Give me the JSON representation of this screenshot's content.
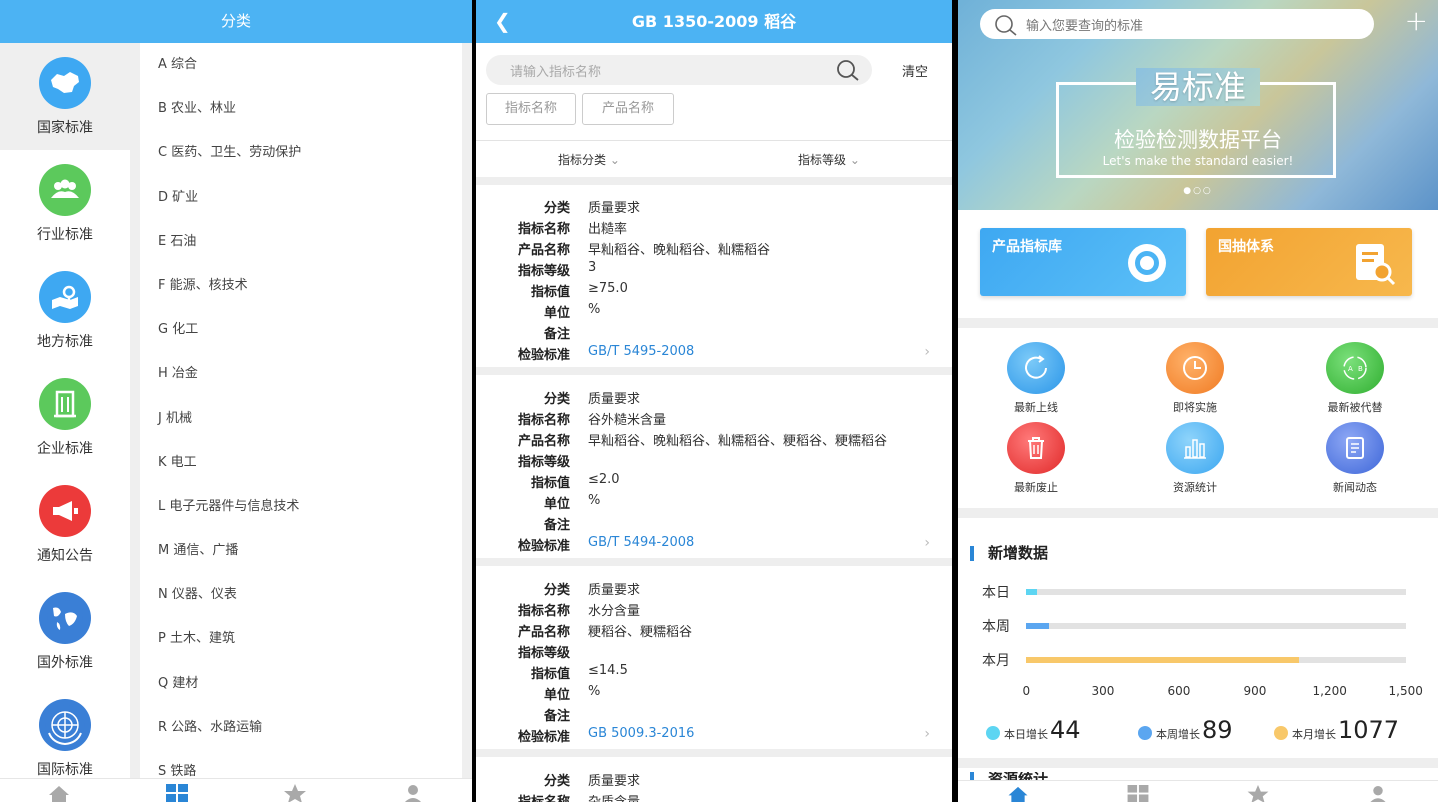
{
  "classify": {
    "header_title": "分类",
    "categories": [
      {
        "label": "国家标准",
        "icon": "china-map-icon",
        "color": "#3ea8f2",
        "active": true
      },
      {
        "label": "行业标准",
        "icon": "people-group-icon",
        "color": "#5cc95c"
      },
      {
        "label": "地方标准",
        "icon": "location-map-icon",
        "color": "#3ea8f2"
      },
      {
        "label": "企业标准",
        "icon": "building-icon",
        "color": "#5cc95c"
      },
      {
        "label": "通知公告",
        "icon": "megaphone-icon",
        "color": "#ec3a3a"
      },
      {
        "label": "国外标准",
        "icon": "globe-icon",
        "color": "#3a7fd6"
      },
      {
        "label": "国际标准",
        "icon": "world-emblem-icon",
        "color": "#3a7fd6"
      }
    ],
    "items": [
      "A 综合",
      "B 农业、林业",
      "C 医药、卫生、劳动保护",
      "D 矿业",
      "E 石油",
      "F 能源、核技术",
      "G 化工",
      "H 冶金",
      "J 机械",
      "K 电工",
      "L 电子元器件与信息技术",
      "M 通信、广播",
      "N 仪器、仪表",
      "P 土木、建筑",
      "Q 建材",
      "R 公路、水路运输",
      "S 铁路"
    ]
  },
  "detail": {
    "back_icon": "back-arrow-icon",
    "title": "GB 1350-2009  稻谷",
    "search_placeholder": "请输入指标名称",
    "clear_label": "清空",
    "chips": [
      "指标名称",
      "产品名称"
    ],
    "filters": [
      "指标分类",
      "指标等级"
    ],
    "field_labels": [
      "分类",
      "指标名称",
      "产品名称",
      "指标等级",
      "指标值",
      "单位",
      "备注",
      "检验标准"
    ],
    "records": [
      {
        "values": [
          "质量要求",
          "出糙率",
          "早籼稻谷、晚籼稻谷、籼糯稻谷",
          "3",
          "≥75.0",
          "%",
          "",
          "GB/T 5495-2008"
        ]
      },
      {
        "values": [
          "质量要求",
          "谷外糙米含量",
          "早籼稻谷、晚籼稻谷、籼糯稻谷、粳稻谷、粳糯稻谷",
          "",
          "≤2.0",
          "%",
          "",
          "GB/T 5494-2008"
        ]
      },
      {
        "values": [
          "质量要求",
          "水分含量",
          "粳稻谷、粳糯稻谷",
          "",
          "≤14.5",
          "%",
          "",
          "GB 5009.3-2016"
        ]
      },
      {
        "values": [
          "质量要求",
          "杂质含量"
        ]
      }
    ]
  },
  "home": {
    "search_placeholder": "输入您要查询的标准",
    "banner": {
      "title": "易标准",
      "subtitle": "检验检测数据平台",
      "tagline": "Let's make the standard easier!"
    },
    "features": [
      {
        "label": "产品指标库",
        "color": "#3ea8f2"
      },
      {
        "label": "国抽体系",
        "color": "#f2a331"
      }
    ],
    "grid": [
      {
        "label": "最新上线",
        "icon": "refresh-icon",
        "color": "#3ea8f2"
      },
      {
        "label": "即将实施",
        "icon": "clock-icon",
        "color": "#f58a2e"
      },
      {
        "label": "最新被代替",
        "icon": "swap-icon",
        "color": "#4cc24c"
      },
      {
        "label": "最新废止",
        "icon": "trash-icon",
        "color": "#ec3a3a"
      },
      {
        "label": "资源统计",
        "icon": "bar-chart-icon",
        "color": "#4fb3f5"
      },
      {
        "label": "新闻动态",
        "icon": "document-icon",
        "color": "#4a7fe0"
      }
    ],
    "stats_title": "新增数据",
    "next_section_title": "资源统计",
    "legend": [
      {
        "label": "本日增长",
        "value": "44",
        "color": "#5dd5f2"
      },
      {
        "label": "本周增长",
        "value": "89",
        "color": "#5ba6f0"
      },
      {
        "label": "本月增长",
        "value": "1077",
        "color": "#f8c86a"
      }
    ]
  },
  "chart_data": {
    "type": "bar",
    "orientation": "horizontal",
    "categories": [
      "本日",
      "本周",
      "本月"
    ],
    "values": [
      44,
      89,
      1077
    ],
    "colors": [
      "#5dd5f2",
      "#5ba6f0",
      "#f8c86a"
    ],
    "xlim": [
      0,
      1500
    ],
    "xticks": [
      "0",
      "300",
      "600",
      "900",
      "1,200",
      "1,500"
    ]
  }
}
